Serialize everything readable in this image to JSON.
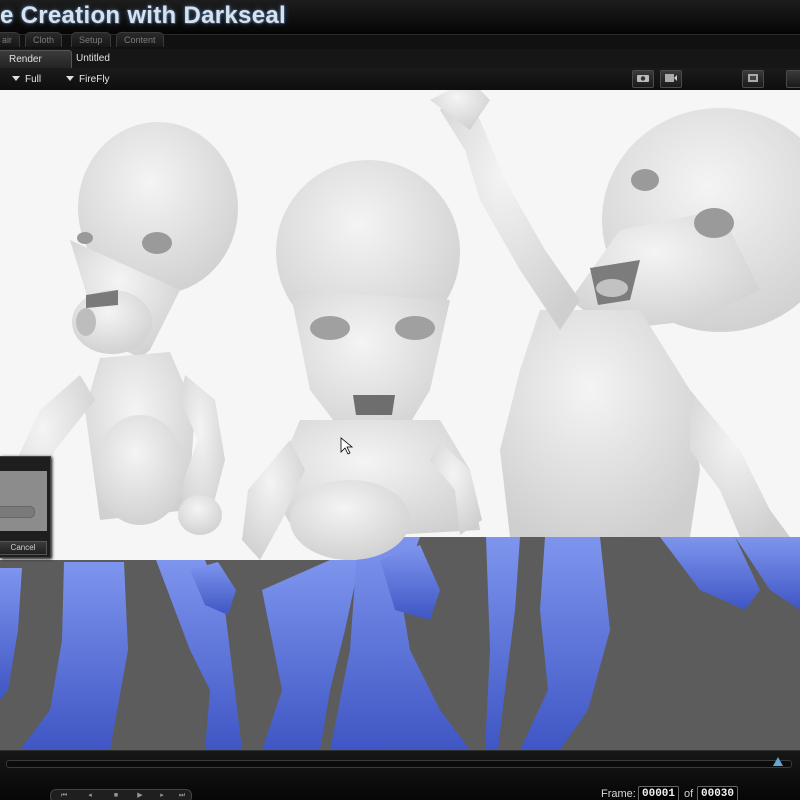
{
  "window": {
    "title": "e Creation with Darkseal"
  },
  "rooms": {
    "tabs": [
      "air",
      "Cloth",
      "Setup",
      "Content"
    ]
  },
  "documents": {
    "tabs": [
      "Render",
      "Untitled"
    ],
    "active": "Render"
  },
  "render_toolbar": {
    "render_area": "Full",
    "renderer": "FireFly",
    "icons": [
      "camera-icon",
      "render-icon",
      "render-settings-icon"
    ]
  },
  "dialog": {
    "cancel_label": "Cancel"
  },
  "timeline": {
    "frame_label": "Frame:",
    "current_frame": "00001",
    "of_label": "of",
    "total_frames": "00030"
  },
  "colors": {
    "render_background": "#f6f6f6",
    "figure_gray": "#e8e8e8",
    "preview_blue": "#6c86e0",
    "viewport_gray": "#5c5c5c",
    "timeline_handle": "#5fa8d8"
  }
}
